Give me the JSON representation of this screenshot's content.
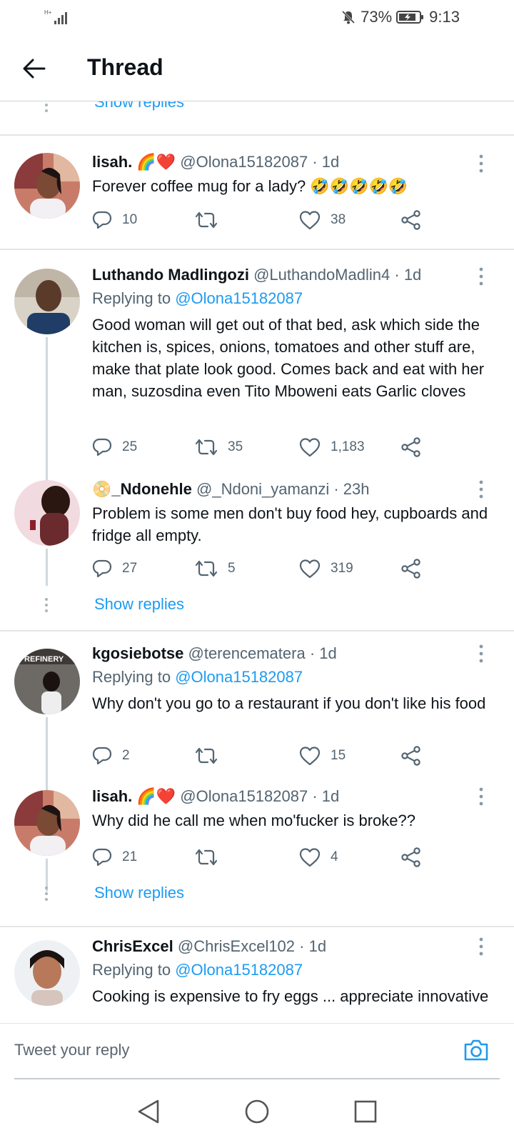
{
  "status": {
    "battery": "73%",
    "time": "9:13",
    "network": "H+"
  },
  "header": {
    "title": "Thread"
  },
  "top_partial": {
    "show_replies": "Show replies"
  },
  "tweets": [
    {
      "name": "lisah.",
      "emoji": "🌈❤️",
      "handle": "@Olona15182087",
      "dot": "·",
      "time": "1d",
      "text": "Forever coffee mug for a lady? 🤣🤣🤣🤣🤣",
      "replies": "10",
      "retweets": "",
      "likes": "38"
    },
    {
      "name": "Luthando Madlingozi",
      "handle": "@LuthandoMadlin4",
      "dot": "·",
      "time": "1d",
      "replying_prefix": "Replying to ",
      "replying_to": "@Olona15182087",
      "text": "Good woman will get out of that bed, ask which side the kitchen is, spices, onions, tomatoes and other stuff are, make that plate look good. Comes back and eat with her man, suzosdina even Tito Mboweni eats Garlic cloves",
      "replies": "25",
      "retweets": "35",
      "likes": "1,183"
    },
    {
      "name": "_Ndonehle",
      "emoji": "📀",
      "handle": "@_Ndoni_yamanzi",
      "dot": "·",
      "time": "23h",
      "text": "Problem is some men don't buy food hey, cupboards and fridge all empty.",
      "replies": "27",
      "retweets": "5",
      "likes": "319",
      "show_replies": "Show replies"
    },
    {
      "name": "kgosiebotse",
      "handle": "@terencematera",
      "dot": "·",
      "time": "1d",
      "replying_prefix": "Replying to ",
      "replying_to": "@Olona15182087",
      "text": "Why don't you go to a restaurant if you don't like his food",
      "replies": "2",
      "retweets": "",
      "likes": "15"
    },
    {
      "name": "lisah.",
      "emoji": "🌈❤️",
      "handle": "@Olona15182087",
      "dot": "·",
      "time": "1d",
      "text": "Why did he call me when mo'fucker is broke??",
      "replies": "21",
      "retweets": "",
      "likes": "4",
      "show_replies": "Show replies"
    },
    {
      "name": "ChrisExcel",
      "handle": "@ChrisExcel102",
      "dot": "·",
      "time": "1d",
      "replying_prefix": "Replying to ",
      "replying_to": "@Olona15182087",
      "text": "Cooking is expensive to fry eggs ... appreciate innovative"
    }
  ],
  "reply_bar": {
    "placeholder": "Tweet your reply"
  },
  "colors": {
    "accent": "#1d9bf0",
    "text": "#0f1419",
    "muted": "#536471",
    "divider": "#e3e6e8"
  },
  "icons": [
    "signal-icon",
    "mute-icon",
    "battery-icon",
    "back-arrow-icon",
    "reply-icon",
    "retweet-icon",
    "like-icon",
    "share-icon",
    "more-icon",
    "camera-icon",
    "nav-back-icon",
    "nav-home-icon",
    "nav-recents-icon"
  ]
}
